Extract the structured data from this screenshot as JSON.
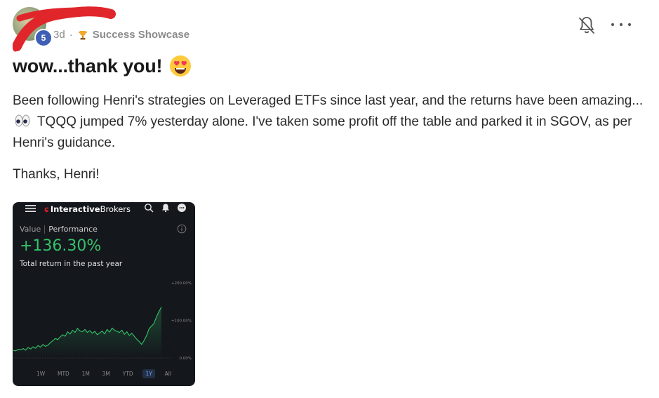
{
  "post": {
    "author_level": "5",
    "age": "3d",
    "separator": "·",
    "category": "Success Showcase",
    "title": "wow...thank you!",
    "title_emoji": "smiling-face-with-heart-eyes",
    "body_part1": "Been following Henri's strategies on Leveraged ETFs since last year, and the returns have been amazing...",
    "body_part2": " TQQQ jumped 7% yesterday alone. I've taken some profit off the table and parked it in SGOV, as per Henri's guidance.",
    "thanks": "Thanks, Henri!"
  },
  "icons": {
    "notifications": "bell-off-icon",
    "more": "more-horizontal-icon",
    "category": "trophy-icon",
    "eyes": "eyes-emoji"
  },
  "colors": {
    "accent_badge": "#3f5fb5",
    "gain_green": "#34c26a",
    "redaction": "#e0262b",
    "screenshot_bg": "#14171c"
  },
  "screenshot": {
    "brand_bold": "Interactive",
    "brand_rest": "Brokers",
    "tab_value": "Value",
    "tab_performance": "Performance",
    "return_pct": "+136.30%",
    "return_label": "Total return in the past year",
    "ranges": [
      "1W",
      "MTD",
      "1M",
      "3M",
      "YTD",
      "1Y",
      "All"
    ],
    "active_range": "1Y"
  },
  "chart_data": {
    "type": "line",
    "title": "",
    "xlabel": "",
    "ylabel": "",
    "y_tick_labels": [
      "+200.00%",
      "+100.00%",
      "0.00%"
    ],
    "ylim": [
      0,
      200
    ],
    "grid": false,
    "x": [
      0,
      1,
      2,
      3,
      4,
      5,
      6,
      7,
      8,
      9,
      10,
      11,
      12,
      13,
      14,
      15,
      16,
      17,
      18,
      19,
      20,
      21,
      22,
      23,
      24,
      25,
      26,
      27,
      28,
      29,
      30,
      31,
      32,
      33,
      34,
      35,
      36,
      37,
      38,
      39,
      40,
      41,
      42,
      43,
      44,
      45,
      46,
      47,
      48,
      49,
      50,
      51,
      52,
      53,
      54,
      55,
      56,
      57,
      58,
      59,
      60
    ],
    "values": [
      20,
      19,
      23,
      22,
      25,
      21,
      28,
      24,
      30,
      26,
      33,
      29,
      36,
      31,
      34,
      41,
      46,
      52,
      49,
      56,
      62,
      58,
      70,
      64,
      74,
      68,
      79,
      72,
      70,
      76,
      68,
      73,
      66,
      71,
      62,
      67,
      72,
      64,
      76,
      69,
      80,
      74,
      71,
      68,
      74,
      63,
      70,
      60,
      66,
      58,
      50,
      44,
      36,
      47,
      60,
      78,
      85,
      92,
      110,
      124,
      136
    ],
    "series": [
      {
        "values_key": "values"
      }
    ]
  }
}
